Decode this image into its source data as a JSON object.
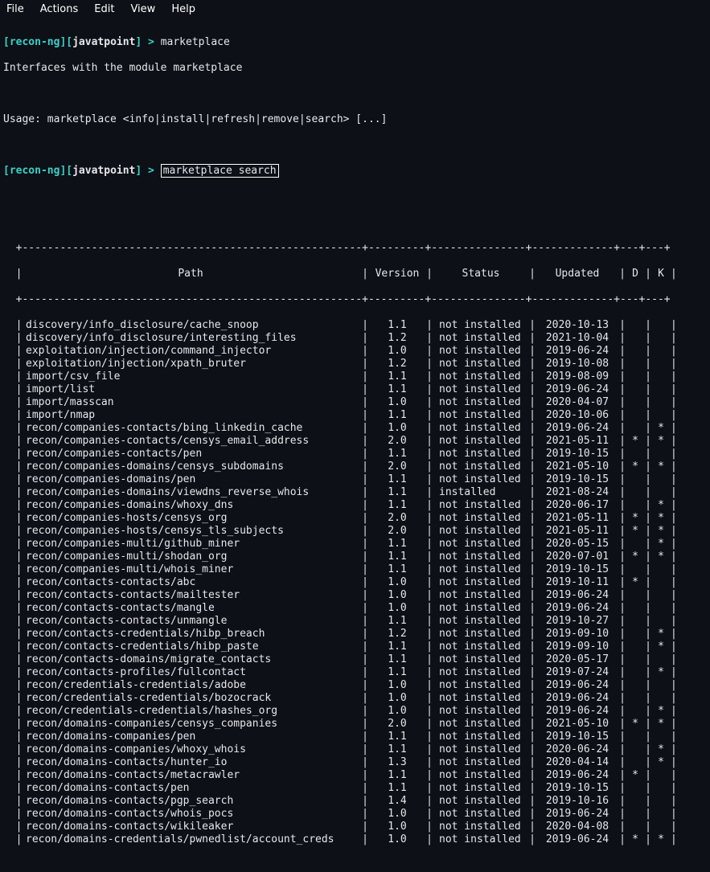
{
  "menubar": [
    "File",
    "Actions",
    "Edit",
    "View",
    "Help"
  ],
  "prompt": {
    "app": "recon-ng",
    "workspace": "javatpoint",
    "cmd1": "marketplace",
    "desc": "Interfaces with the module marketplace",
    "usage": "Usage: marketplace <info|install|refresh|remove|search> [...]",
    "cmd2": "marketplace search"
  },
  "table": {
    "headers": {
      "path": "Path",
      "version": "Version",
      "status": "Status",
      "updated": "Updated",
      "d": "D",
      "k": "K"
    },
    "rows": [
      {
        "path": "discovery/info_disclosure/cache_snoop",
        "version": "1.1",
        "status": "not installed",
        "updated": "2020-10-13",
        "d": "",
        "k": ""
      },
      {
        "path": "discovery/info_disclosure/interesting_files",
        "version": "1.2",
        "status": "not installed",
        "updated": "2021-10-04",
        "d": "",
        "k": ""
      },
      {
        "path": "exploitation/injection/command_injector",
        "version": "1.0",
        "status": "not installed",
        "updated": "2019-06-24",
        "d": "",
        "k": ""
      },
      {
        "path": "exploitation/injection/xpath_bruter",
        "version": "1.2",
        "status": "not installed",
        "updated": "2019-10-08",
        "d": "",
        "k": ""
      },
      {
        "path": "import/csv_file",
        "version": "1.1",
        "status": "not installed",
        "updated": "2019-08-09",
        "d": "",
        "k": ""
      },
      {
        "path": "import/list",
        "version": "1.1",
        "status": "not installed",
        "updated": "2019-06-24",
        "d": "",
        "k": ""
      },
      {
        "path": "import/masscan",
        "version": "1.0",
        "status": "not installed",
        "updated": "2020-04-07",
        "d": "",
        "k": ""
      },
      {
        "path": "import/nmap",
        "version": "1.1",
        "status": "not installed",
        "updated": "2020-10-06",
        "d": "",
        "k": ""
      },
      {
        "path": "recon/companies-contacts/bing_linkedin_cache",
        "version": "1.0",
        "status": "not installed",
        "updated": "2019-06-24",
        "d": "",
        "k": "*"
      },
      {
        "path": "recon/companies-contacts/censys_email_address",
        "version": "2.0",
        "status": "not installed",
        "updated": "2021-05-11",
        "d": "*",
        "k": "*"
      },
      {
        "path": "recon/companies-contacts/pen",
        "version": "1.1",
        "status": "not installed",
        "updated": "2019-10-15",
        "d": "",
        "k": ""
      },
      {
        "path": "recon/companies-domains/censys_subdomains",
        "version": "2.0",
        "status": "not installed",
        "updated": "2021-05-10",
        "d": "*",
        "k": "*"
      },
      {
        "path": "recon/companies-domains/pen",
        "version": "1.1",
        "status": "not installed",
        "updated": "2019-10-15",
        "d": "",
        "k": ""
      },
      {
        "path": "recon/companies-domains/viewdns_reverse_whois",
        "version": "1.1",
        "status": "installed",
        "updated": "2021-08-24",
        "d": "",
        "k": ""
      },
      {
        "path": "recon/companies-domains/whoxy_dns",
        "version": "1.1",
        "status": "not installed",
        "updated": "2020-06-17",
        "d": "",
        "k": "*"
      },
      {
        "path": "recon/companies-hosts/censys_org",
        "version": "2.0",
        "status": "not installed",
        "updated": "2021-05-11",
        "d": "*",
        "k": "*"
      },
      {
        "path": "recon/companies-hosts/censys_tls_subjects",
        "version": "2.0",
        "status": "not installed",
        "updated": "2021-05-11",
        "d": "*",
        "k": "*"
      },
      {
        "path": "recon/companies-multi/github_miner",
        "version": "1.1",
        "status": "not installed",
        "updated": "2020-05-15",
        "d": "",
        "k": "*"
      },
      {
        "path": "recon/companies-multi/shodan_org",
        "version": "1.1",
        "status": "not installed",
        "updated": "2020-07-01",
        "d": "*",
        "k": "*"
      },
      {
        "path": "recon/companies-multi/whois_miner",
        "version": "1.1",
        "status": "not installed",
        "updated": "2019-10-15",
        "d": "",
        "k": ""
      },
      {
        "path": "recon/contacts-contacts/abc",
        "version": "1.0",
        "status": "not installed",
        "updated": "2019-10-11",
        "d": "*",
        "k": ""
      },
      {
        "path": "recon/contacts-contacts/mailtester",
        "version": "1.0",
        "status": "not installed",
        "updated": "2019-06-24",
        "d": "",
        "k": ""
      },
      {
        "path": "recon/contacts-contacts/mangle",
        "version": "1.0",
        "status": "not installed",
        "updated": "2019-06-24",
        "d": "",
        "k": ""
      },
      {
        "path": "recon/contacts-contacts/unmangle",
        "version": "1.1",
        "status": "not installed",
        "updated": "2019-10-27",
        "d": "",
        "k": ""
      },
      {
        "path": "recon/contacts-credentials/hibp_breach",
        "version": "1.2",
        "status": "not installed",
        "updated": "2019-09-10",
        "d": "",
        "k": "*"
      },
      {
        "path": "recon/contacts-credentials/hibp_paste",
        "version": "1.1",
        "status": "not installed",
        "updated": "2019-09-10",
        "d": "",
        "k": "*"
      },
      {
        "path": "recon/contacts-domains/migrate_contacts",
        "version": "1.1",
        "status": "not installed",
        "updated": "2020-05-17",
        "d": "",
        "k": ""
      },
      {
        "path": "recon/contacts-profiles/fullcontact",
        "version": "1.1",
        "status": "not installed",
        "updated": "2019-07-24",
        "d": "",
        "k": "*"
      },
      {
        "path": "recon/credentials-credentials/adobe",
        "version": "1.0",
        "status": "not installed",
        "updated": "2019-06-24",
        "d": "",
        "k": ""
      },
      {
        "path": "recon/credentials-credentials/bozocrack",
        "version": "1.0",
        "status": "not installed",
        "updated": "2019-06-24",
        "d": "",
        "k": ""
      },
      {
        "path": "recon/credentials-credentials/hashes_org",
        "version": "1.0",
        "status": "not installed",
        "updated": "2019-06-24",
        "d": "",
        "k": "*"
      },
      {
        "path": "recon/domains-companies/censys_companies",
        "version": "2.0",
        "status": "not installed",
        "updated": "2021-05-10",
        "d": "*",
        "k": "*"
      },
      {
        "path": "recon/domains-companies/pen",
        "version": "1.1",
        "status": "not installed",
        "updated": "2019-10-15",
        "d": "",
        "k": ""
      },
      {
        "path": "recon/domains-companies/whoxy_whois",
        "version": "1.1",
        "status": "not installed",
        "updated": "2020-06-24",
        "d": "",
        "k": "*"
      },
      {
        "path": "recon/domains-contacts/hunter_io",
        "version": "1.3",
        "status": "not installed",
        "updated": "2020-04-14",
        "d": "",
        "k": "*"
      },
      {
        "path": "recon/domains-contacts/metacrawler",
        "version": "1.1",
        "status": "not installed",
        "updated": "2019-06-24",
        "d": "*",
        "k": ""
      },
      {
        "path": "recon/domains-contacts/pen",
        "version": "1.1",
        "status": "not installed",
        "updated": "2019-10-15",
        "d": "",
        "k": ""
      },
      {
        "path": "recon/domains-contacts/pgp_search",
        "version": "1.4",
        "status": "not installed",
        "updated": "2019-10-16",
        "d": "",
        "k": ""
      },
      {
        "path": "recon/domains-contacts/whois_pocs",
        "version": "1.0",
        "status": "not installed",
        "updated": "2019-06-24",
        "d": "",
        "k": ""
      },
      {
        "path": "recon/domains-contacts/wikileaker",
        "version": "1.0",
        "status": "not installed",
        "updated": "2020-04-08",
        "d": "",
        "k": ""
      },
      {
        "path": "recon/domains-credentials/pwnedlist/account_creds",
        "version": "1.0",
        "status": "not installed",
        "updated": "2019-06-24",
        "d": "*",
        "k": "*"
      }
    ]
  }
}
